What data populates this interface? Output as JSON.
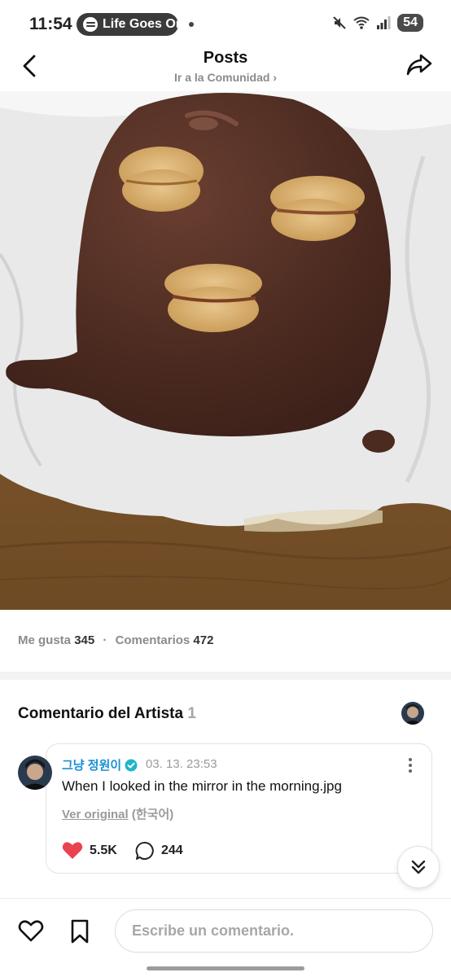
{
  "status_bar": {
    "time": "11:54",
    "media_pill": "Life Goes On",
    "battery": "54"
  },
  "header": {
    "title": "Posts",
    "community_link": "Ir a la Comunidad ›"
  },
  "stats": {
    "likes_label": "Me gusta",
    "likes_count": "345",
    "separator": "·",
    "comments_label": "Comentarios",
    "comments_count": "472"
  },
  "artist_comment": {
    "section_title": "Comentario del Artista",
    "section_count": "1",
    "author": "그냥 정원이",
    "date": "03. 13. 23:53",
    "text": "When I looked in the mirror in the morning.jpg",
    "see_original": "Ver original",
    "language": "(한국어)",
    "likes": "5.5K",
    "replies": "244"
  },
  "bottom_bar": {
    "comment_placeholder": "Escribe un comentario."
  },
  "colors": {
    "verified_blue": "#1b8fd6",
    "like_red": "#e8434f",
    "muted_gray": "#8b8b8b"
  }
}
